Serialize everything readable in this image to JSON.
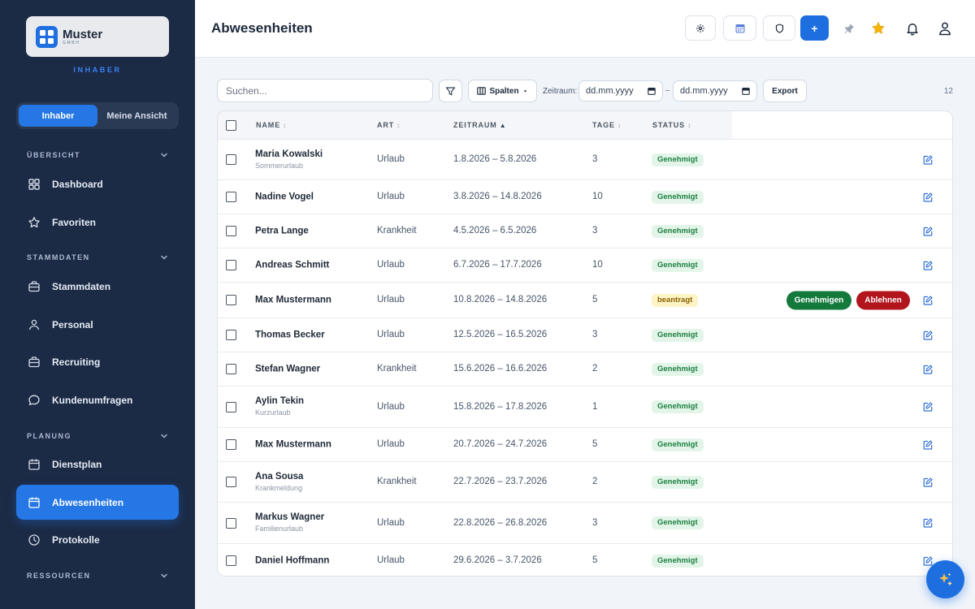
{
  "sidebar": {
    "company": {
      "name": "Muster",
      "suffix": "GMBH"
    },
    "role": "INHABER",
    "view_toggle": {
      "active": "Inhaber",
      "other": "Meine Ansicht"
    },
    "sections": {
      "overview": "ÜBERSICHT",
      "master": "STAMMDATEN",
      "planning": "PLANUNG",
      "resources": "RESSOURCEN"
    },
    "items": {
      "dashboard": "Dashboard",
      "favorites": "Favoriten",
      "masterdata": "Stammdaten",
      "personnel": "Personal",
      "recruiting": "Recruiting",
      "surveys": "Kundenumfragen",
      "roster": "Dienstplan",
      "absences": "Abwesenheiten",
      "logs": "Protokolle"
    }
  },
  "header": {
    "title": "Abwesenheiten",
    "add_label": "+",
    "icons": [
      "gear-icon",
      "calendar-icon",
      "shield-icon",
      "plus-icon",
      "pin-icon",
      "star-icon",
      "bell-icon",
      "user-icon"
    ]
  },
  "toolbar": {
    "search_placeholder": "Suchen...",
    "columns_label": "Spalten",
    "range_label": "Zeitraum:",
    "date_placeholder_from": "dd.mm.yyyy",
    "date_placeholder_to": "dd.mm.yyyy",
    "range_separator": "–",
    "export_label": "Export",
    "count": "12"
  },
  "table": {
    "columns": {
      "name": "NAME",
      "type": "ART",
      "period": "ZEITRAUM",
      "days": "TAGE",
      "status": "STATUS"
    },
    "sort": {
      "name": "↕",
      "type": "↕",
      "period": "▲",
      "days": "↕",
      "status": "↕"
    },
    "approve_label": "Genehmigen",
    "reject_label": "Ablehnen",
    "rows": [
      {
        "name": "Maria Kowalski",
        "note": "Sommerurlaub",
        "type": "Urlaub",
        "period": "1.8.2026 – 5.8.2026",
        "days": "3",
        "status": "Genehmigt"
      },
      {
        "name": "Nadine Vogel",
        "note": "",
        "type": "Urlaub",
        "period": "3.8.2026 – 14.8.2026",
        "days": "10",
        "status": "Genehmigt"
      },
      {
        "name": "Petra Lange",
        "note": "",
        "type": "Krankheit",
        "period": "4.5.2026 – 6.5.2026",
        "days": "3",
        "status": "Genehmigt"
      },
      {
        "name": "Andreas Schmitt",
        "note": "",
        "type": "Urlaub",
        "period": "6.7.2026 – 17.7.2026",
        "days": "10",
        "status": "Genehmigt"
      },
      {
        "name": "Max Mustermann",
        "note": "",
        "type": "Urlaub",
        "period": "10.8.2026 – 14.8.2026",
        "days": "5",
        "status": "beantragt",
        "pending": true
      },
      {
        "name": "Thomas Becker",
        "note": "",
        "type": "Urlaub",
        "period": "12.5.2026 – 16.5.2026",
        "days": "3",
        "status": "Genehmigt"
      },
      {
        "name": "Stefan Wagner",
        "note": "",
        "type": "Krankheit",
        "period": "15.6.2026 – 16.6.2026",
        "days": "2",
        "status": "Genehmigt"
      },
      {
        "name": "Aylin Tekin",
        "note": "Kurzurlaub",
        "type": "Urlaub",
        "period": "15.8.2026 – 17.8.2026",
        "days": "1",
        "status": "Genehmigt"
      },
      {
        "name": "Max Mustermann",
        "note": "",
        "type": "Urlaub",
        "period": "20.7.2026 – 24.7.2026",
        "days": "5",
        "status": "Genehmigt"
      },
      {
        "name": "Ana Sousa",
        "note": "Krankmeldung",
        "type": "Krankheit",
        "period": "22.7.2026 – 23.7.2026",
        "days": "2",
        "status": "Genehmigt"
      },
      {
        "name": "Markus Wagner",
        "note": "Familienurlaub",
        "type": "Urlaub",
        "period": "22.8.2026 – 26.8.2026",
        "days": "3",
        "status": "Genehmigt"
      },
      {
        "name": "Daniel Hoffmann",
        "note": "",
        "type": "Urlaub",
        "period": "29.6.2026 – 3.7.2026",
        "days": "5",
        "status": "Genehmigt"
      }
    ]
  },
  "colors": {
    "sidebar_bg": "#1b2a45",
    "accent": "#1d6fe0",
    "approved_bg": "#e3f5e9",
    "approved_text": "#1b7f3f",
    "pending_bg": "#fdf4c7",
    "approve_btn": "#147a3c",
    "reject_btn": "#b3151d"
  },
  "fab": {
    "icon": "sparkles-icon"
  }
}
